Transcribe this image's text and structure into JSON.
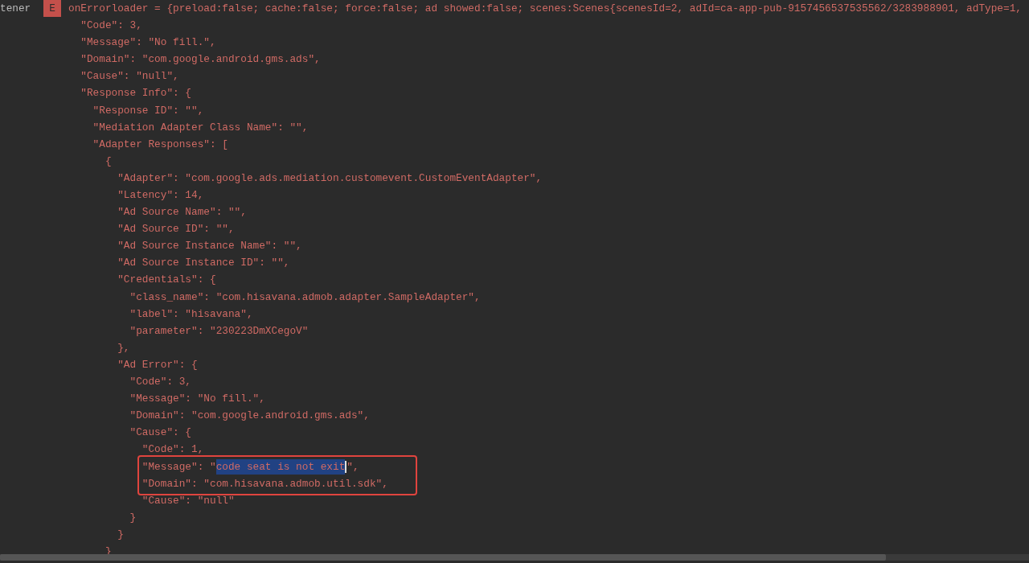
{
  "header": {
    "tag": "tener",
    "level": "E",
    "message": "onErrorloader = {preload:false; cache:false; force:false; ad showed:false; scenes:Scenes{scenesId=2, adId=ca-app-pub-9157456537535562/3283988901, adType=1,"
  },
  "lines": [
    {
      "boxed": false,
      "segments": [
        {
          "text": "  \"Code\": 3,",
          "selected": false
        }
      ]
    },
    {
      "boxed": false,
      "segments": [
        {
          "text": "  \"Message\": \"No fill.\",",
          "selected": false
        }
      ]
    },
    {
      "boxed": false,
      "segments": [
        {
          "text": "  \"Domain\": \"com.google.android.gms.ads\",",
          "selected": false
        }
      ]
    },
    {
      "boxed": false,
      "segments": [
        {
          "text": "  \"Cause\": \"null\",",
          "selected": false
        }
      ]
    },
    {
      "boxed": false,
      "segments": [
        {
          "text": "  \"Response Info\": {",
          "selected": false
        }
      ]
    },
    {
      "boxed": false,
      "segments": [
        {
          "text": "    \"Response ID\": \"\",",
          "selected": false
        }
      ]
    },
    {
      "boxed": false,
      "segments": [
        {
          "text": "    \"Mediation Adapter Class Name\": \"\",",
          "selected": false
        }
      ]
    },
    {
      "boxed": false,
      "segments": [
        {
          "text": "    \"Adapter Responses\": [",
          "selected": false
        }
      ]
    },
    {
      "boxed": false,
      "segments": [
        {
          "text": "      {",
          "selected": false
        }
      ]
    },
    {
      "boxed": false,
      "segments": [
        {
          "text": "        \"Adapter\": \"com.google.ads.mediation.customevent.CustomEventAdapter\",",
          "selected": false
        }
      ]
    },
    {
      "boxed": false,
      "segments": [
        {
          "text": "        \"Latency\": 14,",
          "selected": false
        }
      ]
    },
    {
      "boxed": false,
      "segments": [
        {
          "text": "        \"Ad Source Name\": \"\",",
          "selected": false
        }
      ]
    },
    {
      "boxed": false,
      "segments": [
        {
          "text": "        \"Ad Source ID\": \"\",",
          "selected": false
        }
      ]
    },
    {
      "boxed": false,
      "segments": [
        {
          "text": "        \"Ad Source Instance Name\": \"\",",
          "selected": false
        }
      ]
    },
    {
      "boxed": false,
      "segments": [
        {
          "text": "        \"Ad Source Instance ID\": \"\",",
          "selected": false
        }
      ]
    },
    {
      "boxed": false,
      "segments": [
        {
          "text": "        \"Credentials\": {",
          "selected": false
        }
      ]
    },
    {
      "boxed": false,
      "segments": [
        {
          "text": "          \"class_name\": \"com.hisavana.admob.adapter.SampleAdapter\",",
          "selected": false
        }
      ]
    },
    {
      "boxed": false,
      "segments": [
        {
          "text": "          \"label\": \"hisavana\",",
          "selected": false
        }
      ]
    },
    {
      "boxed": false,
      "segments": [
        {
          "text": "          \"parameter\": \"230223DmXCegoV\"",
          "selected": false
        }
      ]
    },
    {
      "boxed": false,
      "segments": [
        {
          "text": "        },",
          "selected": false
        }
      ]
    },
    {
      "boxed": false,
      "segments": [
        {
          "text": "        \"Ad Error\": {",
          "selected": false
        }
      ]
    },
    {
      "boxed": false,
      "segments": [
        {
          "text": "          \"Code\": 3,",
          "selected": false
        }
      ]
    },
    {
      "boxed": false,
      "segments": [
        {
          "text": "          \"Message\": \"No fill.\",",
          "selected": false
        }
      ]
    },
    {
      "boxed": false,
      "segments": [
        {
          "text": "          \"Domain\": \"com.google.android.gms.ads\",",
          "selected": false
        }
      ]
    },
    {
      "boxed": false,
      "segments": [
        {
          "text": "          \"Cause\": {",
          "selected": false
        }
      ]
    },
    {
      "boxed": false,
      "segments": [
        {
          "text": "            \"Code\": 1,",
          "selected": false
        }
      ]
    },
    {
      "boxed": true,
      "segments": [
        {
          "text": "            \"Message\": \"",
          "selected": false
        },
        {
          "text": "code seat is not exit",
          "selected": true
        },
        {
          "text": "\",",
          "selected": false
        }
      ]
    },
    {
      "boxed": true,
      "segments": [
        {
          "text": "            \"Domain\": \"com.hisavana.admob.util.sdk\",",
          "selected": false
        }
      ]
    },
    {
      "boxed": false,
      "segments": [
        {
          "text": "            \"Cause\": \"null\"",
          "selected": false
        }
      ]
    },
    {
      "boxed": false,
      "segments": [
        {
          "text": "          }",
          "selected": false
        }
      ]
    },
    {
      "boxed": false,
      "segments": [
        {
          "text": "        }",
          "selected": false
        }
      ]
    },
    {
      "boxed": false,
      "segments": [
        {
          "text": "      }",
          "selected": false
        }
      ]
    }
  ]
}
